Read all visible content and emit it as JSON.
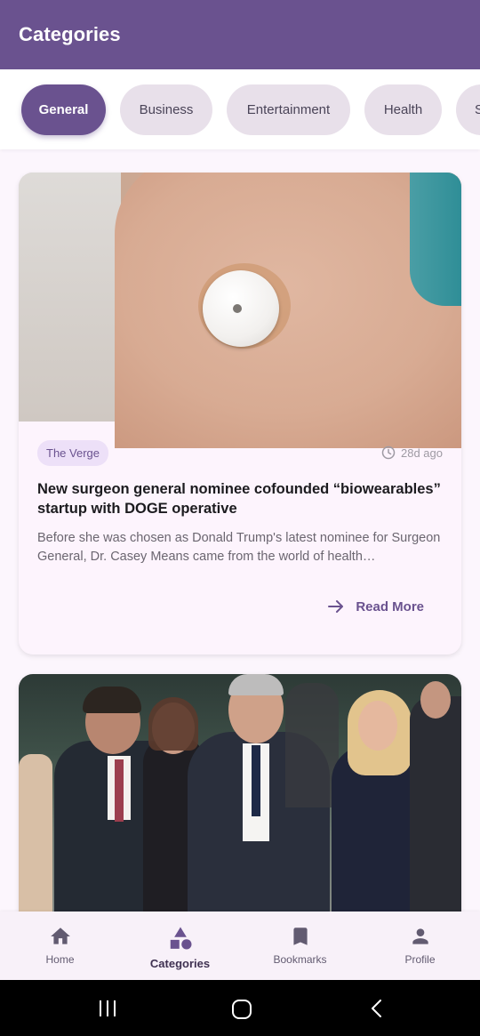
{
  "app_bar": {
    "title": "Categories"
  },
  "categories": [
    "General",
    "Business",
    "Entertainment",
    "Health",
    "S"
  ],
  "articles": [
    {
      "source": "The Verge",
      "time": "28d ago",
      "title": "New surgeon general nominee cofounded “biowearables” startup with DOGE operative",
      "summary": "Before she was chosen as Donald Trump's latest nominee for Surgeon General, Dr. Casey Means came from the world of health…",
      "read_more": "Read More"
    }
  ],
  "bottom_nav": {
    "items": [
      {
        "label": "Home",
        "icon": "home-icon"
      },
      {
        "label": "Categories",
        "icon": "categories-icon",
        "active": true
      },
      {
        "label": "Bookmarks",
        "icon": "bookmark-icon"
      },
      {
        "label": "Profile",
        "icon": "person-icon"
      }
    ]
  },
  "colors": {
    "primary": "#6a528f",
    "chip": "#e8e0ea",
    "background": "#fcf6fd"
  }
}
